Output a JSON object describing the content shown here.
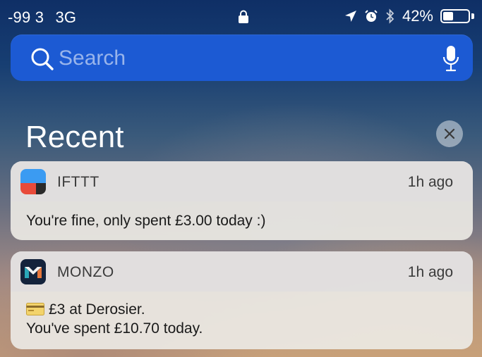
{
  "status_bar": {
    "signal": "-99 3",
    "network": "3G",
    "battery_percent": "42%",
    "battery_level": 0.42
  },
  "search": {
    "placeholder": "Search"
  },
  "recent": {
    "title": "Recent"
  },
  "notifications": [
    {
      "app": "IFTTT",
      "time": "1h ago",
      "line1": "You're fine, only spent £3.00 today :)",
      "icon": "ifttt-icon"
    },
    {
      "app": "MONZO",
      "time": "1h ago",
      "line1": "£3 at Derosier.",
      "line2": "You've spent £10.70 today.",
      "icon": "monzo-icon",
      "emoji": "credit-card-icon"
    }
  ],
  "colors": {
    "search_bg": "#1c5ad3",
    "ifttt_blue": "#3b9bf2",
    "ifttt_red": "#e84a3a",
    "monzo_dark": "#14233c"
  }
}
